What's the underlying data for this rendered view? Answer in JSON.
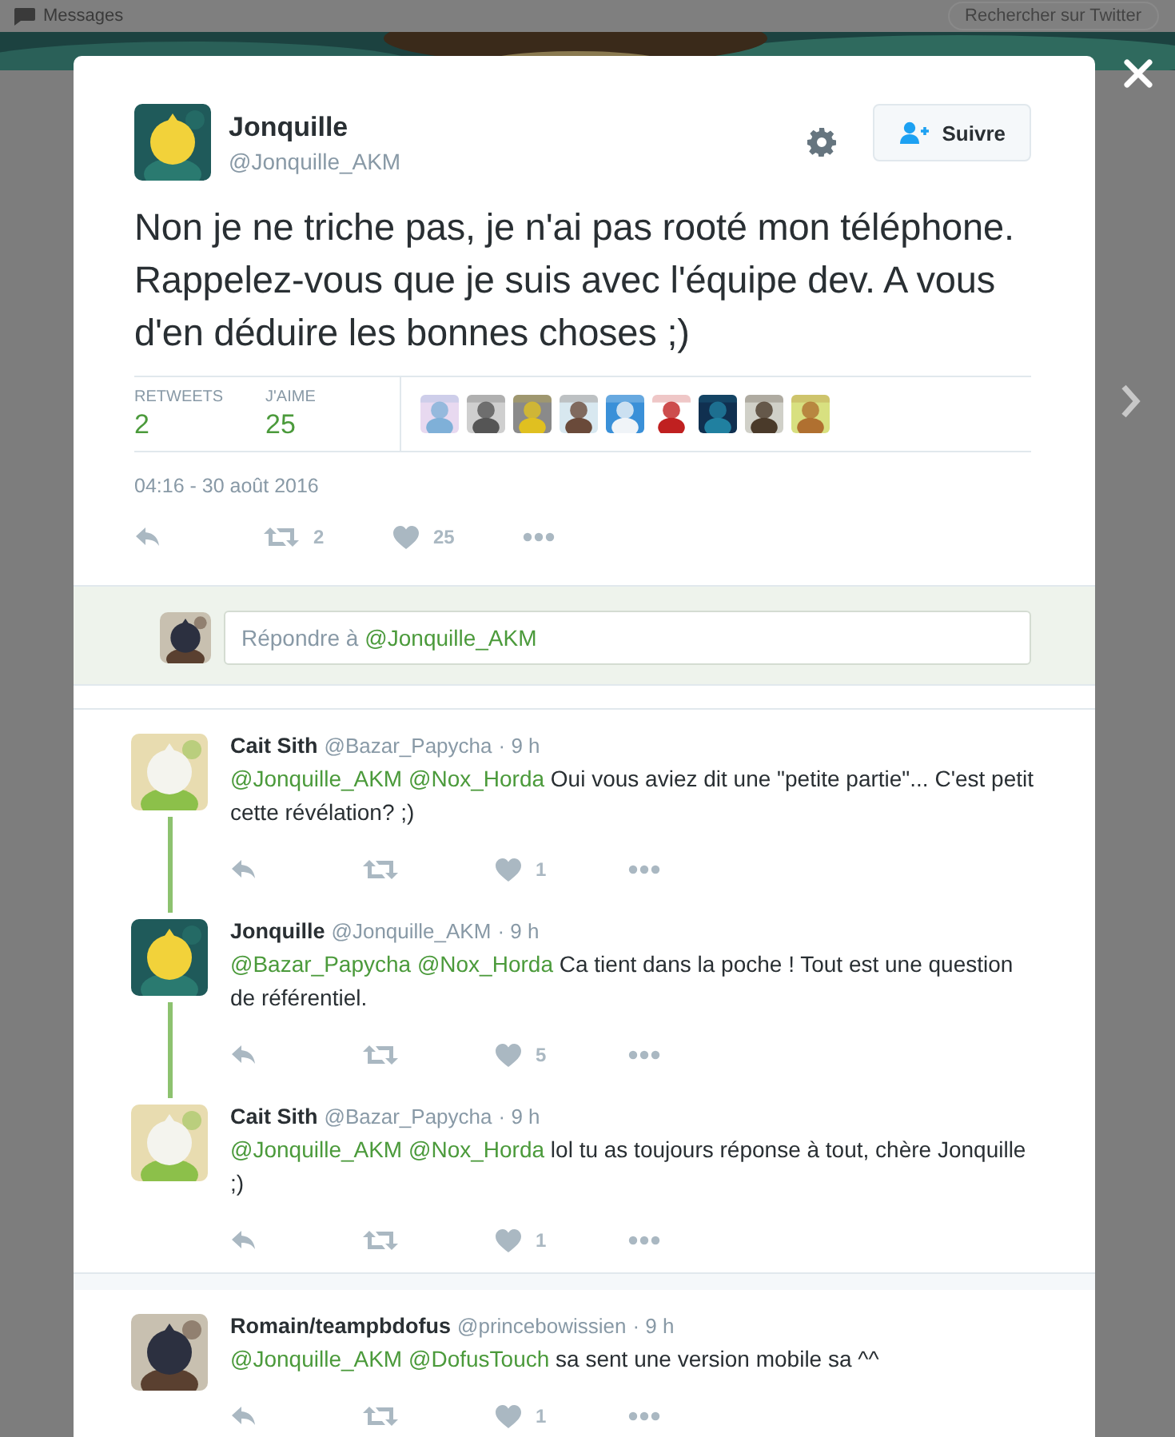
{
  "background": {
    "nav_item": "Messages",
    "search": {
      "placeholder": "Rechercher sur Twitter"
    }
  },
  "tweet": {
    "author": "Jonquille",
    "handle": "@Jonquille_AKM",
    "follow_button": "Suivre",
    "text": "Non je ne triche pas, je n'ai pas rooté mon téléphone. Rappelez-vous que je suis avec l'équipe dev. A vous d'en déduire les bonnes choses ;)",
    "stats": [
      {
        "label": "RETWEETS",
        "value": "2"
      },
      {
        "label": "J'AIME",
        "value": "25"
      }
    ],
    "timestamp": "04:16 - 30 août 2016",
    "actions": {
      "retweets": "2",
      "likes": "25"
    }
  },
  "reply_box": {
    "placeholder": "Répondre à",
    "placeholder_mention": "@Jonquille_AKM"
  },
  "conversations": [
    {
      "replies": [
        {
          "name": "Cait Sith",
          "handle": "@Bazar_Papycha",
          "time": "· 9 h",
          "mentions": [
            "@Jonquille_AKM",
            "@Nox_Horda"
          ],
          "text": " Oui vous aviez dit une \"petite partie\"... C'est petit cette révélation? ;)",
          "likes": "1"
        },
        {
          "name": "Jonquille",
          "handle": "@Jonquille_AKM",
          "time": "· 9 h",
          "mentions": [
            "@Bazar_Papycha",
            "@Nox_Horda"
          ],
          "text": "Ca tient dans la poche ! Tout est une question de référentiel.",
          "likes": "5"
        },
        {
          "name": "Cait Sith",
          "handle": "@Bazar_Papycha",
          "time": "· 9 h",
          "mentions": [
            "@Jonquille_AKM",
            "@Nox_Horda"
          ],
          "text": "lol tu as toujours réponse à tout, chère Jonquille ;)",
          "likes": "1"
        }
      ]
    },
    {
      "replies": [
        {
          "name": "Romain/teampbdofus",
          "handle": "@princebowissien",
          "time": "· 9 h",
          "mentions": [
            "@Jonquille_AKM",
            "@DofusTouch"
          ],
          "text": "sa sent une version mobile sa ^^",
          "likes": "1"
        }
      ]
    }
  ]
}
